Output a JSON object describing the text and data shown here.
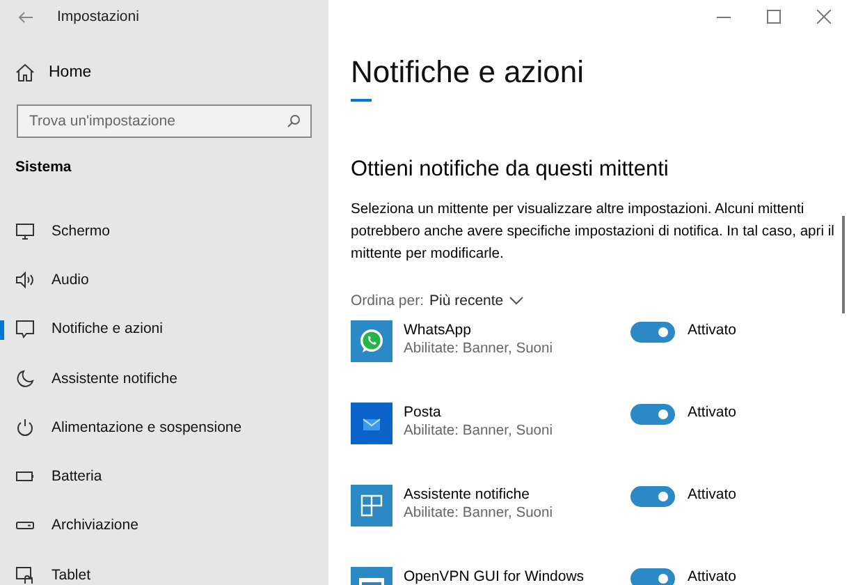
{
  "window": {
    "title": "Impostazioni"
  },
  "sidebar": {
    "home": "Home",
    "search": {
      "placeholder": "Trova un'impostazione"
    },
    "section": "Sistema",
    "items": [
      {
        "label": "Schermo",
        "selected": false
      },
      {
        "label": "Audio",
        "selected": false
      },
      {
        "label": "Notifiche e azioni",
        "selected": true
      },
      {
        "label": "Assistente notifiche",
        "selected": false
      },
      {
        "label": "Alimentazione e sospensione",
        "selected": false
      },
      {
        "label": "Batteria",
        "selected": false
      },
      {
        "label": "Archiviazione",
        "selected": false
      },
      {
        "label": "Tablet",
        "selected": false
      }
    ]
  },
  "page": {
    "title": "Notifiche e azioni",
    "heading": "Ottieni notifiche da questi mittenti",
    "description": "Seleziona un mittente per visualizzare altre impostazioni. Alcuni mittenti potrebbero anche avere specifiche impostazioni di notifica. In tal caso, apri il mittente per modificarle.",
    "sort_label": "Ordina per:",
    "sort_value": "Più recente",
    "senders": [
      {
        "name": "WhatsApp",
        "detail": "Abilitate: Banner, Suoni",
        "on": true,
        "state": "Attivato"
      },
      {
        "name": "Posta",
        "detail": "Abilitate: Banner, Suoni",
        "on": true,
        "state": "Attivato"
      },
      {
        "name": "Assistente notifiche",
        "detail": "Abilitate: Banner, Suoni",
        "on": true,
        "state": "Attivato"
      },
      {
        "name": "OpenVPN GUI for Windows",
        "on": true,
        "state": "Attivato"
      }
    ]
  }
}
